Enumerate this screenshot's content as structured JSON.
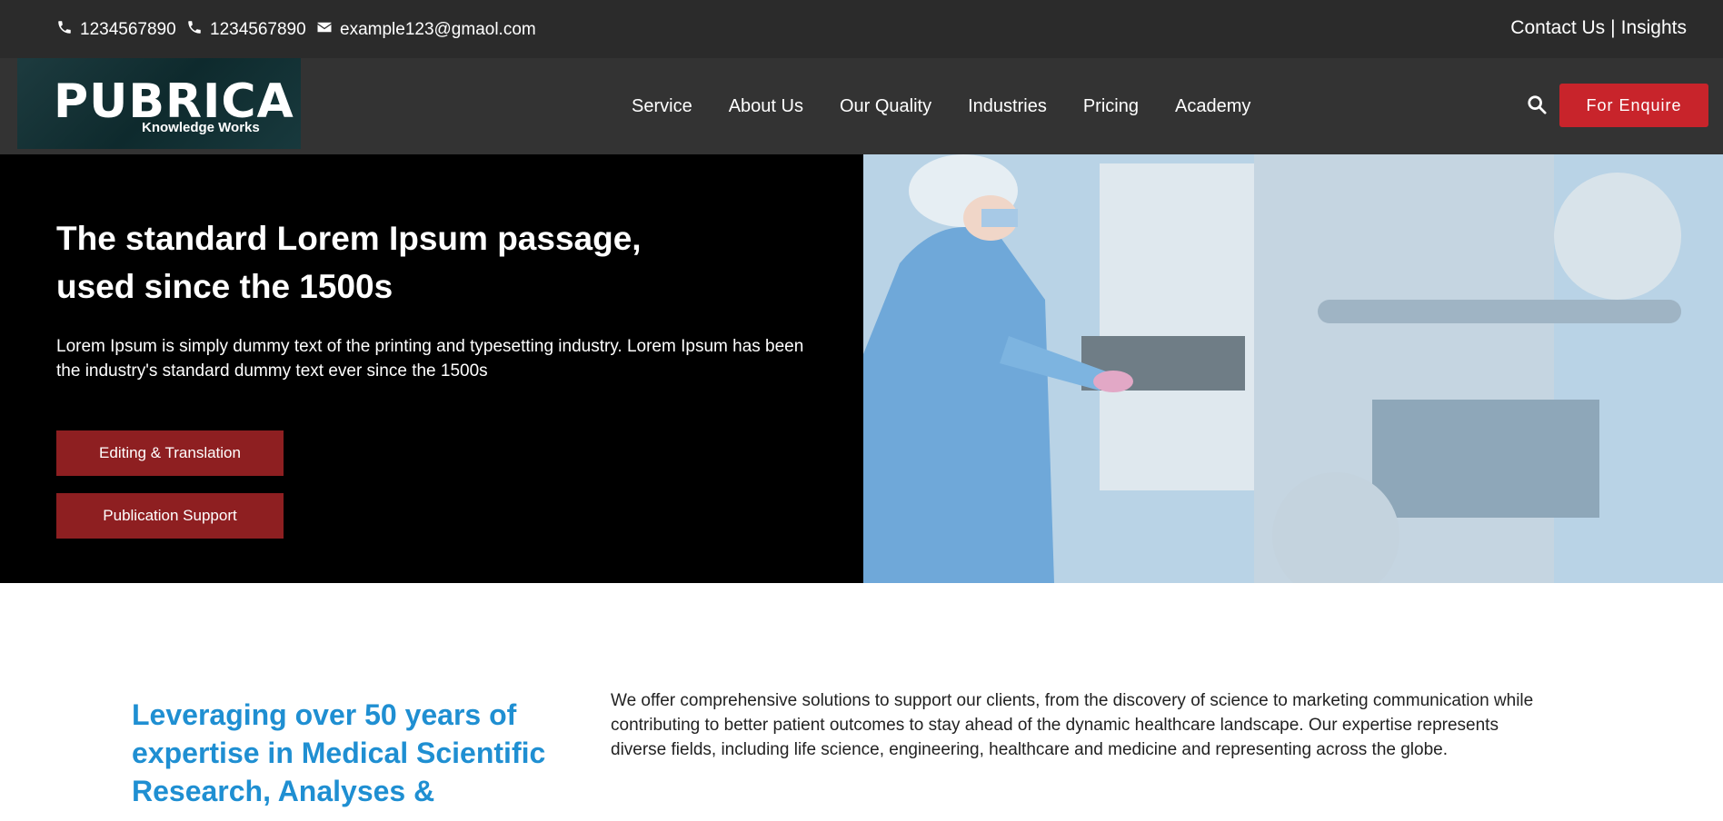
{
  "topbar": {
    "phone1": "1234567890",
    "phone2": "1234567890",
    "email": "example123@gmaol.com",
    "contact_us": "Contact Us",
    "separator": "|",
    "insights": "Insights"
  },
  "navbar": {
    "logo_main": "PUBRICA",
    "logo_sub": "Knowledge Works",
    "links": [
      "Service",
      "About Us",
      "Our Quality",
      "Industries",
      "Pricing",
      "Academy"
    ],
    "enquire_label": "For Enquire"
  },
  "hero": {
    "title": "The standard Lorem Ipsum passage, used since the 1500s",
    "text_line1": "Lorem Ipsum is simply dummy text of the printing and typesetting industry. Lorem Ipsum has been",
    "text_line2": "the industry's standard dummy text ever since the 1500s",
    "button1": "Editing & Translation",
    "button2": "Publication Support"
  },
  "about": {
    "heading": "Leveraging over 50 years of expertise in Medical Scientific Research, Analyses &",
    "text": "We offer comprehensive solutions to support our clients, from the discovery of science to marketing communication while contributing to better patient outcomes to stay ahead of the dynamic healthcare landscape. Our expertise represents diverse fields, including life science, engineering, healthcare and medicine and representing across the globe."
  },
  "colors": {
    "topbar_bg": "#2b2b2b",
    "navbar_bg": "#333333",
    "enquire_bg": "#c8242b",
    "hero_button_bg": "#8e1f21",
    "heading_blue": "#1f8fd2"
  },
  "icons": [
    "phone-icon",
    "phone-icon",
    "envelope-icon",
    "search-icon"
  ]
}
